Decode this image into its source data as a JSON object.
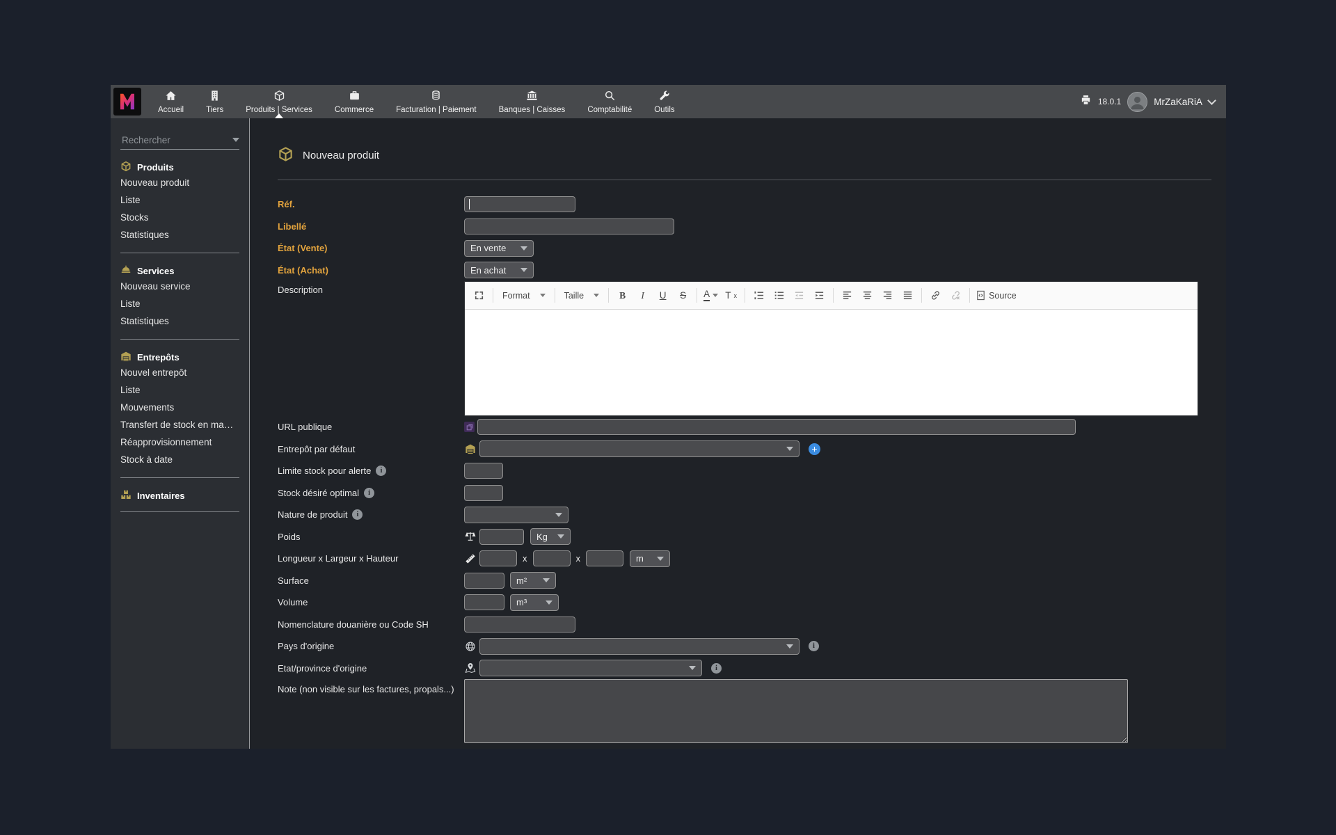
{
  "app": {
    "version": "18.0.1",
    "user": "MrZaKaRiA"
  },
  "topbar": {
    "menu": [
      {
        "label": "Accueil",
        "icon": "home-icon"
      },
      {
        "label": "Tiers",
        "icon": "building-icon"
      },
      {
        "label": "Produits | Services",
        "icon": "cube-icon",
        "active": true
      },
      {
        "label": "Commerce",
        "icon": "briefcase-icon"
      },
      {
        "label": "Facturation | Paiement",
        "icon": "coins-icon"
      },
      {
        "label": "Banques | Caisses",
        "icon": "bank-icon"
      },
      {
        "label": "Comptabilité",
        "icon": "magnifier-icon"
      },
      {
        "label": "Outils",
        "icon": "wrench-icon"
      }
    ]
  },
  "sidebar": {
    "search_placeholder": "Rechercher",
    "sections": [
      {
        "title": "Produits",
        "icon": "cube-icon",
        "items": [
          "Nouveau produit",
          "Liste",
          "Stocks",
          "Statistiques"
        ]
      },
      {
        "title": "Services",
        "icon": "bell-icon",
        "items": [
          "Nouveau service",
          "Liste",
          "Statistiques"
        ]
      },
      {
        "title": "Entrepôts",
        "icon": "warehouse-icon",
        "items": [
          "Nouvel entrepôt",
          "Liste",
          "Mouvements",
          "Transfert de stock en ma…",
          "Réapprovisionnement",
          "Stock à date"
        ]
      },
      {
        "title": "Inventaires",
        "icon": "boxes-icon",
        "items": []
      }
    ]
  },
  "page": {
    "title": "Nouveau produit"
  },
  "form": {
    "ref_label": "Réf.",
    "libelle_label": "Libellé",
    "etat_vente_label": "État (Vente)",
    "etat_vente_value": "En vente",
    "etat_achat_label": "État (Achat)",
    "etat_achat_value": "En achat",
    "description_label": "Description",
    "url_label": "URL publique",
    "entrepot_label": "Entrepôt par défaut",
    "limite_label": "Limite stock pour alerte",
    "stock_desire_label": "Stock désiré optimal",
    "nature_label": "Nature de produit",
    "poids_label": "Poids",
    "poids_unit": "Kg",
    "dim_label": "Longueur x Largeur x Hauteur",
    "dim_sep": "x",
    "dim_unit": "m",
    "surface_label": "Surface",
    "surface_unit": "m²",
    "volume_label": "Volume",
    "volume_unit": "m³",
    "nomenclature_label": "Nomenclature douanière ou Code SH",
    "pays_label": "Pays d'origine",
    "province_label": "Etat/province d'origine",
    "note_label": "Note (non visible sur les factures, propals...)"
  },
  "editor": {
    "format_label": "Format",
    "taille_label": "Taille",
    "bold": "B",
    "italic": "I",
    "underline": "U",
    "strike": "S",
    "color": "A",
    "removeformat_t": "T",
    "removeformat_x": "x",
    "source_label": "Source"
  },
  "colors": {
    "accent_gold": "#b3a053",
    "required_label": "#e2a33d",
    "add_button_blue": "#3b8ce0"
  }
}
